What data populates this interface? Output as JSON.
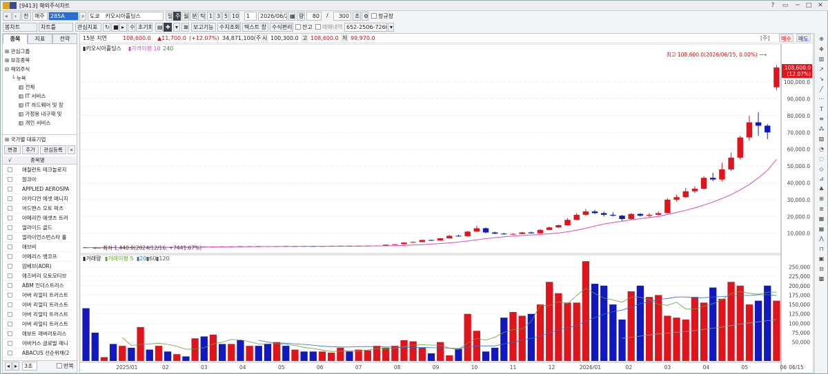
{
  "window": {
    "title": "[9413] 해외주식차트",
    "btn_min": "─",
    "btn_max": "□",
    "btn_close": "✕",
    "btn_help": "?",
    "btn_pin": "▭"
  },
  "toolbar1": {
    "prev": "«",
    "prev2": "‹",
    "all": "전",
    "market": "해주",
    "code": "285A",
    "search_glyph": "⌕",
    "exchange": "도쿄",
    "name": "키오시아홀딩스",
    "period_tabs": [
      "일",
      "주",
      "월",
      "분",
      "틱",
      "1",
      "3",
      "5",
      "10"
    ],
    "period_active": "주",
    "count": "1",
    "date": "2026/06/21",
    "calendar": "▦",
    "qty_label": "량",
    "qty": "80",
    "slash": "/",
    "qty_total": "300",
    "refresh": "조회",
    "gear": "⚙",
    "normal_price": "정규장"
  },
  "toolbar2": {
    "buttons": [
      "봉차트",
      "차트틀",
      "관심지표",
      "↻",
      "■",
      "▸",
      "수",
      "초기화"
    ],
    "tools": [
      "▤",
      "✚",
      "▾",
      "⊠"
    ],
    "buttons2": [
      "보고기능",
      "수치조회",
      "텍스트 창",
      "수식편리"
    ],
    "balance_label": "잔고",
    "account_label": "매매내역",
    "account": "652-2506-7260-0",
    "combo_arrow": "▾"
  },
  "left": {
    "tabs": [
      "종목",
      "지표",
      "전략"
    ],
    "tree": [
      {
        "t": "⊞ 관심그룹",
        "d": 0
      },
      {
        "t": "⊞ 보유종목",
        "d": 0
      },
      {
        "t": "⊟ 해외주식",
        "d": 0
      },
      {
        "t": "└ 뉴욕",
        "d": 1
      },
      {
        "t": "▥ 전체",
        "d": 2
      },
      {
        "t": "▥ IT 서비스",
        "d": 2
      },
      {
        "t": "▥ IT 하드웨어 및 장",
        "d": 2
      },
      {
        "t": "▥ 가정용 내구재 및",
        "d": 2
      },
      {
        "t": "▥ 개인 서비스",
        "d": 2
      }
    ],
    "section2": "⊞ 국가별 대표기업",
    "buttons": [
      "변경",
      "추가",
      "관심등록",
      "«"
    ],
    "grid_check": "√",
    "grid_header": "종목명",
    "stocks": [
      "애질런트 테크놀로지",
      "알코아",
      "APPLIED AEROSPA",
      "아카디언 에셋 매니지",
      "어드밴스 오토 파츠",
      "아메리칸 에셋츠 트러",
      "얼라이드 골드",
      "얼라이언스번스타 홀",
      "애브비",
      "아메리스 뱅코프",
      "암베브(ADR)",
      "애즈버리 오토모티브",
      "ABM 인더스트리스",
      "아버 리얼티 트러스트",
      "아버 리얼티 트러스트",
      "아버 리얼티 트러스트",
      "아버 리얼티 트러스트",
      "애보트 래버러토리스",
      "아바커스 글로벌 매니",
      "ABACUS 선순위채(2"
    ],
    "footer": [
      "◂",
      "▸",
      "3초",
      "반복"
    ]
  },
  "info": {
    "interval": "15분 지연",
    "price": "108,600.0",
    "change": "▲11,700.0",
    "change_pct": "(+12.07%)",
    "volume": "34,871,100(주)",
    "open_label": "시",
    "open": "100,300.0",
    "high_label": "고",
    "high": "108,600.0",
    "low_label": "저",
    "low": "99,970.0",
    "buy": "매수",
    "sell": "매도",
    "bracket": "[주]"
  },
  "right_icons": [
    "⊕",
    "✥",
    "▥",
    "↗",
    "↘",
    "╱",
    "⋯",
    "T",
    "≡",
    "⁂",
    "▨",
    "◔",
    "◌",
    "◇",
    "⊿",
    "♣",
    "⊞",
    "≣",
    "▦",
    "▦",
    "⋀",
    "⊓",
    "▣",
    "⊟",
    "▩"
  ],
  "colors": {
    "up": "#e0141c",
    "down": "#1218c0",
    "ma_price": "#d94cc0",
    "ma5": "#6a9e3a",
    "ma20": "#2a6ed0",
    "ma60": "#9a9a9a"
  },
  "chart_data": {
    "type": "candlestick",
    "title": "키오시아홀딩스",
    "price_legend": [
      "키오시아홀딩스",
      "가격이평 10",
      "240"
    ],
    "volume_legend": [
      "거래량",
      "거래이평 5",
      "20",
      "60",
      "120"
    ],
    "max_note": "최고 108,600.0(2026/06/15, 0.00%)",
    "min_note": "최저 1,440.0(2024/12/16, +7441.67%)",
    "last_price_box": [
      "108,600.0",
      "(12.07%)"
    ],
    "price_ylim": [
      -2000,
      116000
    ],
    "price_ticks": [
      "10,000.0",
      "20,000.0",
      "30,000.0",
      "40,000.0",
      "50,000.0",
      "60,000.0",
      "70,000.0",
      "80,000.0",
      "90,000.0",
      "100,000.0"
    ],
    "volume_ylim": [
      0,
      260000
    ],
    "volume_ticks": [
      "50,000",
      "75,000",
      "100,000",
      "125,000",
      "150,000",
      "175,000",
      "200,000",
      "225,000",
      "250,000"
    ],
    "x_labels": [
      "2025/01",
      "02",
      "03",
      "04",
      "05",
      "06",
      "07",
      "08",
      "09",
      "10",
      "11",
      "12",
      "2026/01",
      "02",
      "03",
      "04",
      "05",
      "06",
      "06/15"
    ],
    "candles": [
      [
        1600,
        1500,
        1700,
        1440
      ],
      [
        1550,
        1500,
        1650,
        1480
      ],
      [
        1520,
        1600,
        1700,
        1500
      ],
      [
        1650,
        1580,
        1750,
        1550
      ],
      [
        1600,
        1700,
        1800,
        1580
      ],
      [
        1700,
        1650,
        1800,
        1600
      ],
      [
        1650,
        1750,
        1850,
        1620
      ],
      [
        1800,
        1700,
        1900,
        1650
      ],
      [
        1700,
        1800,
        1950,
        1680
      ],
      [
        1850,
        1800,
        2000,
        1750
      ],
      [
        1800,
        1900,
        2100,
        1750
      ],
      [
        1950,
        1850,
        2100,
        1800
      ],
      [
        1850,
        2000,
        2150,
        1800
      ],
      [
        2050,
        2000,
        2200,
        1950
      ],
      [
        2000,
        2100,
        2300,
        1950
      ],
      [
        2150,
        2050,
        2300,
        2000
      ],
      [
        2100,
        2150,
        2300,
        2000
      ],
      [
        2200,
        2150,
        2400,
        2100
      ],
      [
        2150,
        2300,
        2450,
        2100
      ],
      [
        2350,
        2300,
        2500,
        2200
      ],
      [
        2300,
        2250,
        2450,
        2200
      ],
      [
        2250,
        2350,
        2500,
        2200
      ],
      [
        2400,
        2350,
        2550,
        2300
      ],
      [
        2350,
        2400,
        2600,
        2300
      ],
      [
        2450,
        2400,
        2600,
        2350
      ],
      [
        2400,
        2350,
        2550,
        2300
      ],
      [
        2350,
        2400,
        2550,
        2300
      ],
      [
        2400,
        2450,
        2600,
        2350
      ],
      [
        2450,
        2500,
        2700,
        2400
      ],
      [
        2500,
        2450,
        2650,
        2400
      ],
      [
        2450,
        2550,
        2700,
        2400
      ],
      [
        2550,
        2600,
        2800,
        2500
      ],
      [
        2600,
        2700,
        2900,
        2550
      ],
      [
        2700,
        3200,
        3300,
        2650
      ],
      [
        3200,
        3500,
        3700,
        3100
      ],
      [
        3500,
        4500,
        4700,
        3400
      ],
      [
        4500,
        4800,
        5200,
        4300
      ],
      [
        4800,
        6000,
        6200,
        4700
      ],
      [
        6000,
        5800,
        6300,
        5500
      ],
      [
        5800,
        7000,
        7300,
        5700
      ],
      [
        7000,
        8500,
        9000,
        6900
      ],
      [
        8500,
        8300,
        9200,
        8000
      ],
      [
        8300,
        11000,
        11500,
        8200
      ],
      [
        11000,
        13000,
        14500,
        10800
      ],
      [
        13000,
        10500,
        13500,
        10000
      ],
      [
        10500,
        9800,
        11000,
        9500
      ],
      [
        9800,
        9500,
        10200,
        9200
      ],
      [
        9500,
        9600,
        10000,
        9300
      ],
      [
        9600,
        10500,
        10800,
        9400
      ],
      [
        10500,
        10000,
        11000,
        9800
      ],
      [
        10000,
        12000,
        12500,
        9900
      ],
      [
        12000,
        13500,
        14000,
        11800
      ],
      [
        13500,
        14800,
        15200,
        13200
      ],
      [
        14800,
        18000,
        19000,
        14600
      ],
      [
        18000,
        21000,
        22000,
        17800
      ],
      [
        21000,
        23000,
        24500,
        20500
      ],
      [
        23000,
        22000,
        24000,
        21500
      ],
      [
        22000,
        21000,
        23000,
        20000
      ],
      [
        21000,
        20500,
        22500,
        20000
      ],
      [
        20500,
        18500,
        21000,
        17500
      ],
      [
        18500,
        21500,
        22000,
        18000
      ],
      [
        21500,
        20500,
        22000,
        20000
      ],
      [
        20500,
        21000,
        22000,
        19500
      ],
      [
        21000,
        22000,
        23000,
        20500
      ],
      [
        22000,
        30000,
        31000,
        21800
      ],
      [
        30000,
        31500,
        33000,
        29000
      ],
      [
        31500,
        35000,
        37000,
        31000
      ],
      [
        35000,
        36500,
        38000,
        34000
      ],
      [
        36500,
        43000,
        44000,
        36000
      ],
      [
        43000,
        42000,
        46000,
        41000
      ],
      [
        42000,
        48000,
        52000,
        41000
      ],
      [
        48000,
        55000,
        58000,
        47000
      ],
      [
        55000,
        67000,
        68000,
        54000
      ],
      [
        67000,
        76000,
        80000,
        65000
      ],
      [
        76000,
        74000,
        82000,
        68000
      ],
      [
        74000,
        70000,
        75000,
        66000
      ],
      [
        96900,
        108600,
        110000,
        95000
      ]
    ],
    "volumes": [
      140000,
      75000,
      10000,
      45000,
      40000,
      35000,
      90000,
      30000,
      40000,
      25000,
      18000,
      12000,
      60000,
      65000,
      70000,
      45000,
      45000,
      55000,
      40000,
      40000,
      45000,
      50000,
      40000,
      30000,
      25000,
      25000,
      25000,
      22000,
      35000,
      25000,
      30000,
      28000,
      40000,
      35000,
      40000,
      55000,
      52000,
      35000,
      20000,
      50000,
      15000,
      32000,
      125000,
      80000,
      25000,
      35000,
      115000,
      130000,
      120000,
      125000,
      150000,
      210000,
      180000,
      155000,
      155000,
      265000,
      205000,
      200000,
      150000,
      110000,
      185000,
      200000,
      170000,
      175000,
      120000,
      115000,
      110000,
      170000,
      155000,
      195000,
      165000,
      210000,
      200000,
      150000,
      160000,
      200000,
      160000
    ],
    "ma_price_10": [
      1500,
      1520,
      1540,
      1560,
      1580,
      1600,
      1620,
      1640,
      1660,
      1690,
      1720,
      1750,
      1780,
      1810,
      1850,
      1890,
      1920,
      1960,
      2000,
      2050,
      2090,
      2130,
      2170,
      2210,
      2250,
      2280,
      2310,
      2340,
      2370,
      2400,
      2430,
      2460,
      2500,
      2550,
      2620,
      2760,
      2980,
      3260,
      3560,
      3880,
      4300,
      4800,
      5400,
      6100,
      6800,
      7400,
      7900,
      8300,
      8700,
      9000,
      9300,
      9700,
      10200,
      10900,
      11800,
      13000,
      14300,
      15500,
      16400,
      17200,
      18000,
      18700,
      19400,
      20000,
      21200,
      22400,
      23700,
      25100,
      26800,
      28600,
      30700,
      33000,
      35800,
      39000,
      43000,
      47500,
      54000
    ],
    "vol_ma5": [
      null,
      null,
      null,
      null,
      62000,
      41000,
      44000,
      45000,
      47000,
      44000,
      39000,
      31000,
      32000,
      35000,
      45000,
      50000,
      57000,
      56000,
      51000,
      45000,
      45000,
      46000,
      44000,
      41000,
      36000,
      33000,
      29000,
      25000,
      26000,
      27000,
      27000,
      29000,
      32000,
      32000,
      33000,
      38000,
      42000,
      43000,
      42000,
      42000,
      34000,
      30000,
      48000,
      60000,
      55000,
      63000,
      76000,
      83000,
      85000,
      105000,
      148000,
      147000,
      157000,
      152000,
      174000,
      193000,
      179000,
      167000,
      162000,
      156000,
      170000,
      169000,
      163000,
      150000,
      148000,
      156000,
      138000,
      138000,
      145000,
      152000,
      163000,
      179000,
      184000,
      180000,
      177000,
      183000,
      183000
    ],
    "vol_ma20": [
      null,
      null,
      null,
      null,
      null,
      null,
      null,
      null,
      null,
      null,
      null,
      null,
      null,
      null,
      null,
      null,
      null,
      null,
      null,
      55000,
      50000,
      48000,
      47000,
      45000,
      44000,
      42000,
      39000,
      38000,
      37000,
      37000,
      38000,
      38000,
      38000,
      37000,
      37000,
      36000,
      36000,
      36000,
      35000,
      35000,
      34000,
      33000,
      37000,
      40000,
      40000,
      40000,
      45000,
      50000,
      55000,
      60000,
      66000,
      75000,
      82000,
      88000,
      94000,
      106000,
      115000,
      124000,
      131000,
      135000,
      143000,
      152000,
      158000,
      163000,
      166000,
      170000,
      170000,
      168000,
      168000,
      170000,
      171000,
      173000,
      174000,
      174000,
      176000,
      176000,
      174000
    ],
    "vol_ma60": [
      null,
      null,
      null,
      null,
      null,
      null,
      null,
      null,
      null,
      null,
      null,
      null,
      null,
      null,
      null,
      null,
      null,
      null,
      null,
      null,
      null,
      null,
      null,
      null,
      null,
      null,
      null,
      null,
      null,
      null,
      null,
      null,
      null,
      null,
      null,
      null,
      null,
      null,
      null,
      null,
      null,
      null,
      null,
      null,
      null,
      null,
      null,
      null,
      null,
      null,
      null,
      null,
      null,
      null,
      null,
      null,
      null,
      null,
      null,
      60000,
      63000,
      66000,
      69000,
      72000,
      74000,
      76000,
      78000,
      81000,
      84000,
      87000,
      90000,
      94000,
      98000,
      101000,
      104000,
      107000,
      110000
    ]
  }
}
